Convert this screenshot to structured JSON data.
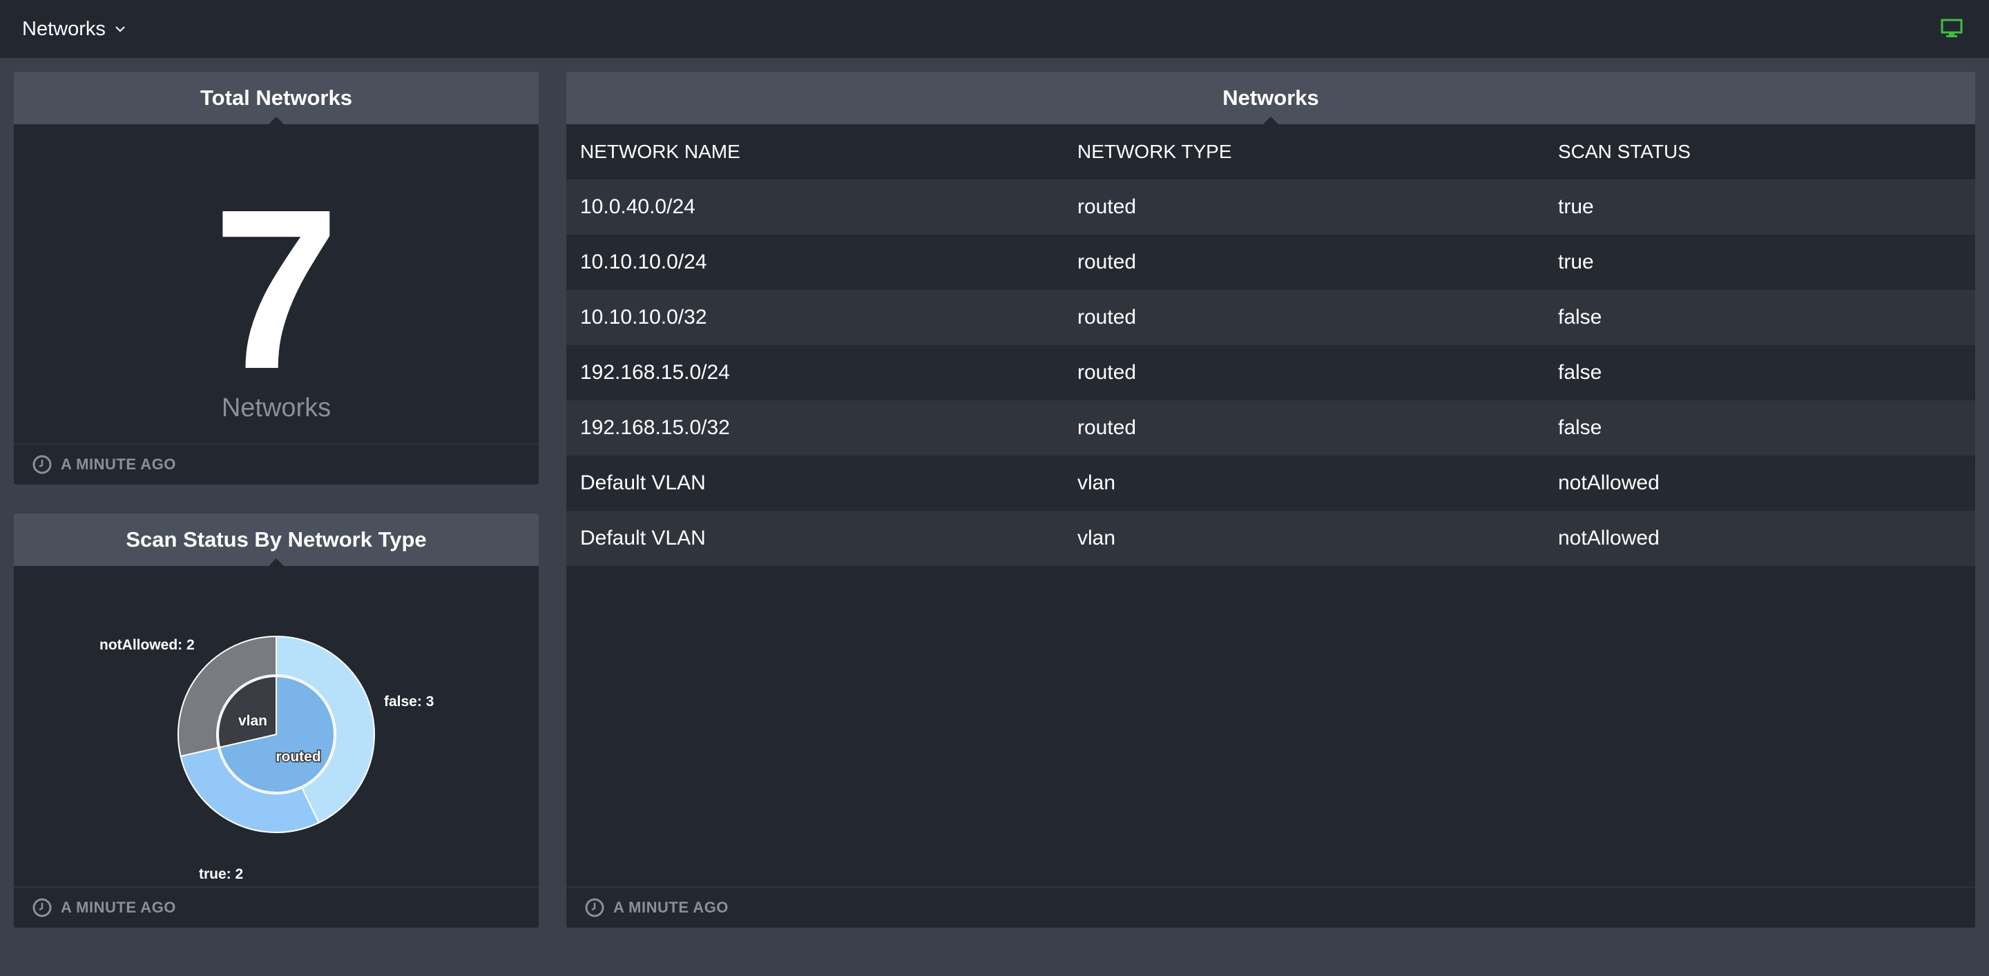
{
  "header": {
    "title": "Networks",
    "dropdown_icon": "chevron-down-icon",
    "monitor_icon": "monitor-icon",
    "monitor_color": "#3fbf3f"
  },
  "total_card": {
    "title": "Total Networks",
    "value": "7",
    "label": "Networks",
    "updated": "A MINUTE AGO"
  },
  "scan_card": {
    "title": "Scan Status By Network Type",
    "updated": "A MINUTE AGO"
  },
  "chart_data": {
    "type": "pie",
    "title": "Scan Status By Network Type",
    "inner": [
      {
        "label": "routed",
        "value": 5,
        "color": "#7ab4e8"
      },
      {
        "label": "vlan",
        "value": 2,
        "color": "#3a3d44"
      }
    ],
    "outer": [
      {
        "label": "false: 3",
        "value": 3,
        "parent": "routed",
        "color": "#b7e1fb"
      },
      {
        "label": "true: 2",
        "value": 2,
        "parent": "routed",
        "color": "#94c8f8"
      },
      {
        "label": "notAllowed: 2",
        "value": 2,
        "parent": "vlan",
        "color": "#7a7b80"
      }
    ]
  },
  "table_card": {
    "title": "Networks",
    "updated": "A MINUTE AGO",
    "columns": [
      "NETWORK NAME",
      "NETWORK TYPE",
      "SCAN STATUS"
    ],
    "rows": [
      [
        "10.0.40.0/24",
        "routed",
        "true"
      ],
      [
        "10.10.10.0/24",
        "routed",
        "true"
      ],
      [
        "10.10.10.0/32",
        "routed",
        "false"
      ],
      [
        "192.168.15.0/24",
        "routed",
        "false"
      ],
      [
        "192.168.15.0/32",
        "routed",
        "false"
      ],
      [
        "Default VLAN",
        "vlan",
        "notAllowed"
      ],
      [
        "Default VLAN",
        "vlan",
        "notAllowed"
      ]
    ]
  }
}
